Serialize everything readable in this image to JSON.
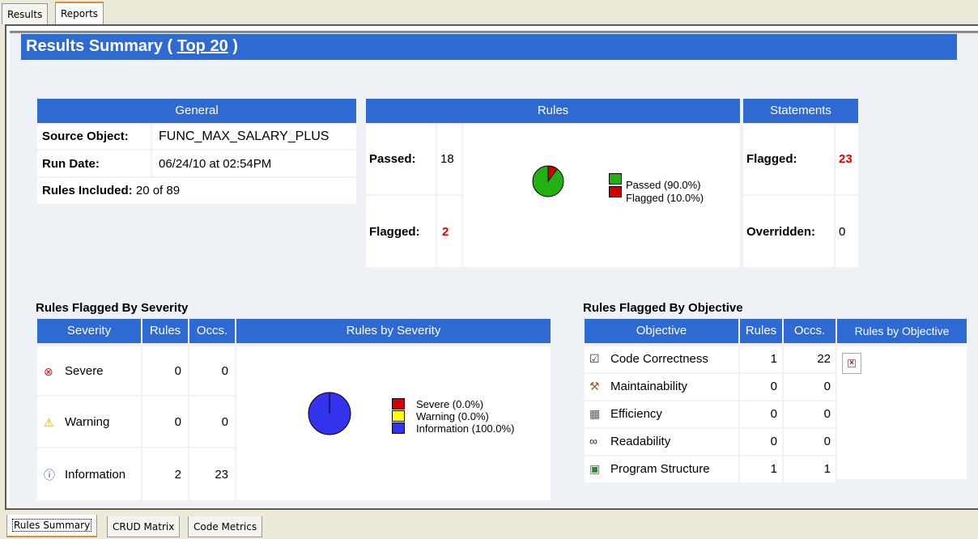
{
  "top_tabs": [
    "Results",
    "Reports"
  ],
  "banner": {
    "prefix": "Results Summary ( ",
    "link": "Top 20",
    "suffix": " )"
  },
  "general": {
    "header": "General",
    "rows": [
      {
        "label": "Source Object:",
        "value": "FUNC_MAX_SALARY_PLUS"
      },
      {
        "label": "Run Date:",
        "value": "06/24/10 at 02:54PM"
      },
      {
        "label": "Rules Included:",
        "value": "20 of 89"
      }
    ]
  },
  "rules": {
    "header": "Rules",
    "passed_label": "Passed:",
    "passed_value": "18",
    "flagged_label": "Flagged:",
    "flagged_value": "2",
    "legend": [
      "Passed (90.0%)",
      "Flagged (10.0%)"
    ],
    "pie": [
      {
        "name": "Passed",
        "pct": 90.0,
        "color": "#22b014"
      },
      {
        "name": "Flagged",
        "pct": 10.0,
        "color": "#d00000"
      }
    ]
  },
  "statements": {
    "header": "Statements",
    "flagged_label": "Flagged:",
    "flagged_value": "23",
    "overridden_label": "Overridden:",
    "overridden_value": "0"
  },
  "severity": {
    "title": "Rules Flagged By Severity",
    "headers": [
      "Severity",
      "Rules",
      "Occs.",
      "Rules by Severity"
    ],
    "rows": [
      {
        "icon": "severe-icon",
        "name": "Severe",
        "rules": "0",
        "occs": "0"
      },
      {
        "icon": "warning-icon",
        "name": "Warning",
        "rules": "0",
        "occs": "0"
      },
      {
        "icon": "information-icon",
        "name": "Information",
        "rules": "2",
        "occs": "23"
      }
    ],
    "legend": [
      "Severe (0.0%)",
      "Warning (0.0%)",
      "Information (100.0%)"
    ],
    "legend_colors": [
      "#d00000",
      "#ffff00",
      "#3333ee"
    ]
  },
  "objective": {
    "title": "Rules Flagged By Objective",
    "headers": [
      "Objective",
      "Rules",
      "Occs.",
      "Rules by Objective"
    ],
    "rows": [
      {
        "icon": "checklist-icon",
        "name": "Code Correctness",
        "rules": "1",
        "occs": "22"
      },
      {
        "icon": "toolbox-icon",
        "name": "Maintainability",
        "rules": "0",
        "occs": "0"
      },
      {
        "icon": "chart-icon",
        "name": "Efficiency",
        "rules": "0",
        "occs": "0"
      },
      {
        "icon": "glasses-icon",
        "name": "Readability",
        "rules": "0",
        "occs": "0"
      },
      {
        "icon": "structure-icon",
        "name": "Program Structure",
        "rules": "1",
        "occs": "1"
      }
    ]
  },
  "bottom_tabs": [
    "Rules Summary",
    "CRUD Matrix",
    "Code Metrics"
  ]
}
